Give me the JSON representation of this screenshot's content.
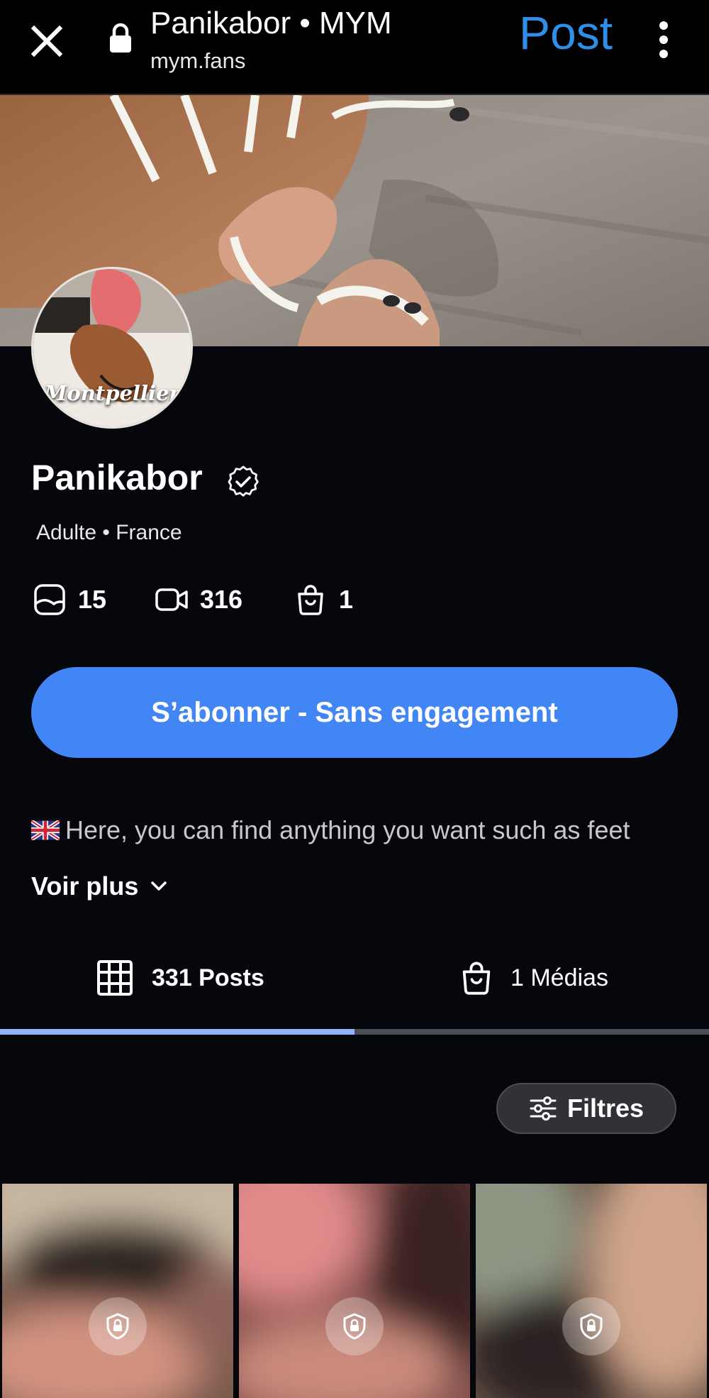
{
  "browser": {
    "title": "Panikabor • MYM",
    "url": "mym.fans",
    "post_label": "Post"
  },
  "profile": {
    "avatar_caption": "Montpellier",
    "name": "Panikabor",
    "meta": "Adulte • France",
    "stats": [
      {
        "icon": "photo-icon",
        "value": "15"
      },
      {
        "icon": "video-icon",
        "value": "316"
      },
      {
        "icon": "shopping-bag-icon",
        "value": "1"
      }
    ],
    "subscribe_label": "S’abonner - Sans engagement",
    "bio": "Here, you can find anything you want such as feet",
    "see_more_label": "Voir plus"
  },
  "tabs": [
    {
      "icon": "grid-icon",
      "label": "331 Posts",
      "active": true
    },
    {
      "icon": "shopping-bag-icon",
      "label": "1 Médias",
      "active": false
    }
  ],
  "filters_label": "Filtres",
  "grid": {
    "tiles": [
      {
        "locked": true
      },
      {
        "locked": true
      },
      {
        "locked": true
      }
    ]
  },
  "colors": {
    "accent": "#4285f4",
    "post_link": "#2f8fe8",
    "background": "#05070c",
    "active_tab_indicator": "#8fb4f8"
  }
}
